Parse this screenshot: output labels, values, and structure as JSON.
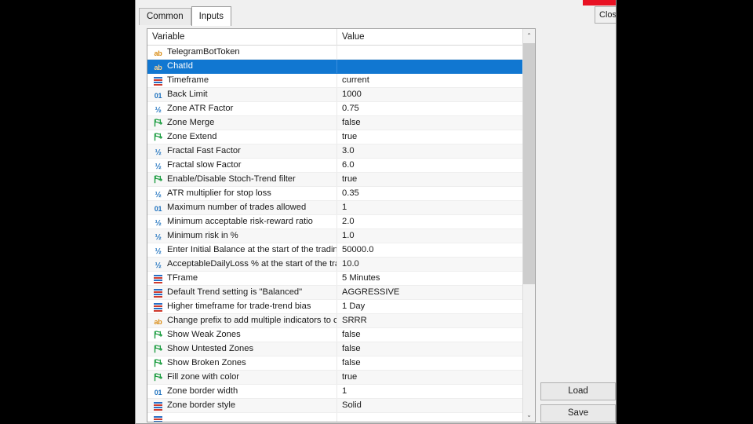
{
  "window": {
    "close_label": "Close"
  },
  "tabs": [
    {
      "label": "Common",
      "active": false
    },
    {
      "label": "Inputs",
      "active": true
    }
  ],
  "grid": {
    "headers": {
      "variable": "Variable",
      "value": "Value"
    },
    "rows": [
      {
        "icon": "string-type-icon",
        "icon_glyph": "ab",
        "name": "TelegramBotToken",
        "value": "",
        "selected": false
      },
      {
        "icon": "string-type-icon",
        "icon_glyph": "ab",
        "name": "ChatId",
        "value": "",
        "selected": true
      },
      {
        "icon": "enum-type-icon",
        "icon_glyph": "",
        "name": "Timeframe",
        "value": "current",
        "selected": false
      },
      {
        "icon": "int-type-icon",
        "icon_glyph": "01",
        "name": "Back Limit",
        "value": "1000",
        "selected": false
      },
      {
        "icon": "double-type-icon",
        "icon_glyph": "½",
        "name": "Zone ATR Factor",
        "value": "0.75",
        "selected": false
      },
      {
        "icon": "bool-type-icon",
        "icon_glyph": "",
        "name": "Zone Merge",
        "value": "false",
        "selected": false
      },
      {
        "icon": "bool-type-icon",
        "icon_glyph": "",
        "name": "Zone Extend",
        "value": "true",
        "selected": false
      },
      {
        "icon": "double-type-icon",
        "icon_glyph": "½",
        "name": "Fractal Fast Factor",
        "value": "3.0",
        "selected": false
      },
      {
        "icon": "double-type-icon",
        "icon_glyph": "½",
        "name": "Fractal slow Factor",
        "value": "6.0",
        "selected": false
      },
      {
        "icon": "bool-type-icon",
        "icon_glyph": "",
        "name": "Enable/Disable Stoch-Trend filter",
        "value": "true",
        "selected": false
      },
      {
        "icon": "double-type-icon",
        "icon_glyph": "½",
        "name": "ATR multiplier for stop loss",
        "value": "0.35",
        "selected": false
      },
      {
        "icon": "int-type-icon",
        "icon_glyph": "01",
        "name": "Maximum number of trades allowed",
        "value": "1",
        "selected": false
      },
      {
        "icon": "double-type-icon",
        "icon_glyph": "½",
        "name": "Minimum acceptable risk-reward ratio",
        "value": "2.0",
        "selected": false
      },
      {
        "icon": "double-type-icon",
        "icon_glyph": "½",
        "name": "Minimum risk in %",
        "value": "1.0",
        "selected": false
      },
      {
        "icon": "double-type-icon",
        "icon_glyph": "½",
        "name": "Enter Initial Balance at the start of the trading...",
        "value": "50000.0",
        "selected": false
      },
      {
        "icon": "double-type-icon",
        "icon_glyph": "½",
        "name": "AcceptableDailyLoss % at the start of the tra...",
        "value": "10.0",
        "selected": false
      },
      {
        "icon": "enum-type-icon",
        "icon_glyph": "",
        "name": "TFrame",
        "value": "5 Minutes",
        "selected": false
      },
      {
        "icon": "enum-type-icon",
        "icon_glyph": "",
        "name": "Default Trend setting is \"Balanced\"",
        "value": "AGGRESSIVE",
        "selected": false
      },
      {
        "icon": "enum-type-icon",
        "icon_glyph": "",
        "name": "Higher timeframe for trade-trend bias",
        "value": "1 Day",
        "selected": false
      },
      {
        "icon": "string-type-icon",
        "icon_glyph": "ab",
        "name": "Change prefix to add multiple indicators to chart",
        "value": "SRRR",
        "selected": false
      },
      {
        "icon": "bool-type-icon",
        "icon_glyph": "",
        "name": "Show Weak Zones",
        "value": "false",
        "selected": false
      },
      {
        "icon": "bool-type-icon",
        "icon_glyph": "",
        "name": "Show Untested Zones",
        "value": "false",
        "selected": false
      },
      {
        "icon": "bool-type-icon",
        "icon_glyph": "",
        "name": "Show Broken Zones",
        "value": "false",
        "selected": false
      },
      {
        "icon": "bool-type-icon",
        "icon_glyph": "",
        "name": "Fill zone with color",
        "value": "true",
        "selected": false
      },
      {
        "icon": "int-type-icon",
        "icon_glyph": "01",
        "name": "Zone border width",
        "value": "1",
        "selected": false
      },
      {
        "icon": "enum-type-icon",
        "icon_glyph": "",
        "name": "Zone border style",
        "value": "Solid",
        "selected": false
      },
      {
        "icon": "enum-type-icon",
        "icon_glyph": "",
        "name": "",
        "value": "",
        "selected": false
      }
    ]
  },
  "scrollbar": {
    "up_arrow": "⌃",
    "down_arrow": "⌄"
  },
  "buttons": {
    "load": "Load",
    "save": "Save"
  },
  "colors": {
    "selection": "#1177d1",
    "titlebar_red": "#e81123",
    "string_icon": "#d98c14",
    "numeric_icon": "#1a6fbd",
    "bool_icon": "#1e9e42"
  }
}
